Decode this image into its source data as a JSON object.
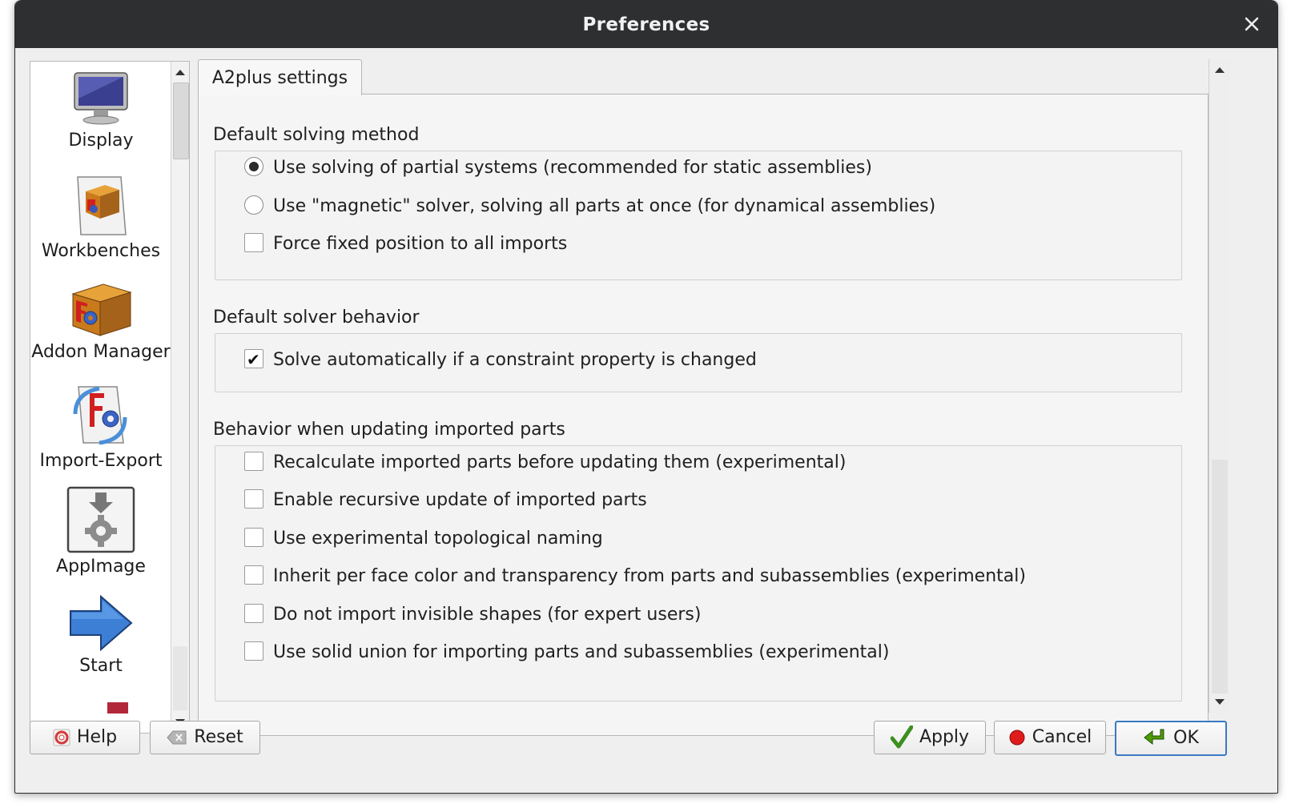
{
  "window": {
    "title": "Preferences"
  },
  "sidebar": {
    "items": [
      {
        "label": "Display",
        "icon": "display-monitor-icon"
      },
      {
        "label": "Workbenches",
        "icon": "workbenches-icon"
      },
      {
        "label": "Addon Manager",
        "icon": "addon-manager-icon"
      },
      {
        "label": "Import-Export",
        "icon": "import-export-icon"
      },
      {
        "label": "AppImage",
        "icon": "appimage-icon"
      },
      {
        "label": "Start",
        "icon": "start-arrow-icon"
      }
    ]
  },
  "tabs": [
    {
      "label": "A2plus settings",
      "active": true
    }
  ],
  "sections": {
    "solving_method": {
      "title": "Default solving method",
      "options": [
        {
          "label": "Use solving of partial systems (recommended for static assemblies)",
          "type": "radio",
          "checked": true
        },
        {
          "label": "Use \"magnetic\" solver, solving all parts at once (for dynamical assemblies)",
          "type": "radio",
          "checked": false
        },
        {
          "label": "Force fixed position to all imports",
          "type": "checkbox",
          "checked": false
        }
      ]
    },
    "solver_behavior": {
      "title": "Default solver behavior",
      "options": [
        {
          "label": "Solve automatically if a constraint property is changed",
          "type": "checkbox",
          "checked": true
        }
      ]
    },
    "update_behavior": {
      "title": "Behavior when updating imported parts",
      "options": [
        {
          "label": "Recalculate imported parts before updating them (experimental)",
          "type": "checkbox",
          "checked": false
        },
        {
          "label": "Enable recursive update of imported parts",
          "type": "checkbox",
          "checked": false
        },
        {
          "label": "Use experimental topological naming",
          "type": "checkbox",
          "checked": false
        },
        {
          "label": "Inherit per face color and transparency from parts and subassemblies (experimental)",
          "type": "checkbox",
          "checked": false
        },
        {
          "label": "Do not import invisible shapes (for expert users)",
          "type": "checkbox",
          "checked": false
        },
        {
          "label": "Use solid union for importing parts and subassemblies (experimental)",
          "type": "checkbox",
          "checked": false
        }
      ]
    }
  },
  "buttons": {
    "help": "Help",
    "reset": "Reset",
    "apply": "Apply",
    "cancel": "Cancel",
    "ok": "OK"
  },
  "colors": {
    "titlebar": "#2d2f31",
    "accent": "#3b78c4",
    "cancel_red": "#e01b1b",
    "apply_green": "#3c8f1e"
  }
}
